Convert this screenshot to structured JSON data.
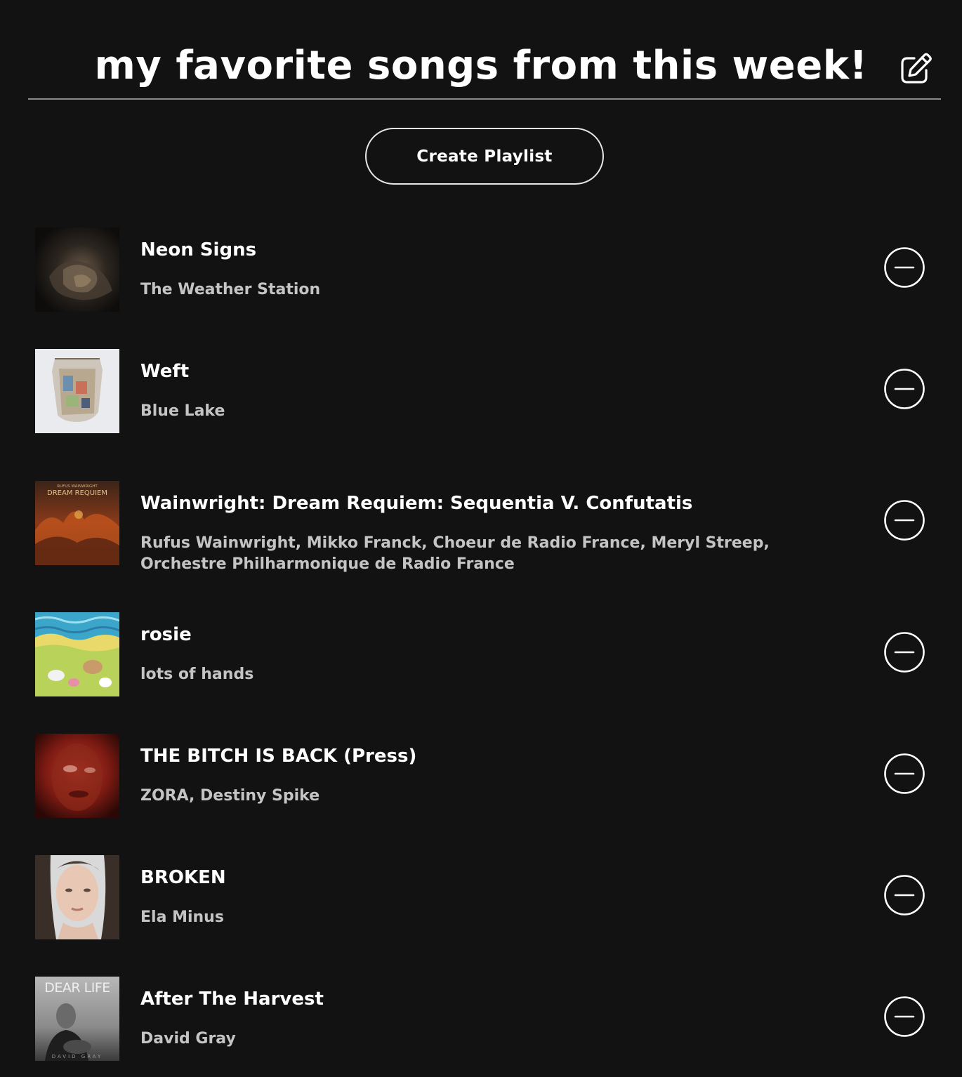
{
  "header": {
    "title": "my favorite songs from this week!",
    "edit_icon": "edit-square-pencil-icon"
  },
  "actions": {
    "create_playlist_label": "Create Playlist"
  },
  "colors": {
    "background": "#121212",
    "text_primary": "#ffffff",
    "text_secondary": "#c4c4c4",
    "divider": "#8a8a8a"
  },
  "tracks": [
    {
      "title": "Neon Signs",
      "artist": "The Weather Station",
      "remove_icon": "minus-circle-icon"
    },
    {
      "title": "Weft",
      "artist": "Blue Lake",
      "remove_icon": "minus-circle-icon"
    },
    {
      "title": "Wainwright: Dream Requiem: Sequentia V. Confutatis",
      "artist": "Rufus Wainwright, Mikko Franck, Choeur de Radio France, Meryl Streep, Orchestre Philharmonique de Radio France",
      "remove_icon": "minus-circle-icon"
    },
    {
      "title": "rosie",
      "artist": "lots of hands",
      "remove_icon": "minus-circle-icon"
    },
    {
      "title": "THE BITCH IS BACK (Press)",
      "artist": "ZORA, Destiny Spike",
      "remove_icon": "minus-circle-icon"
    },
    {
      "title": "BROKEN",
      "artist": "Ela Minus",
      "remove_icon": "minus-circle-icon"
    },
    {
      "title": "After The Harvest",
      "artist": "David Gray",
      "remove_icon": "minus-circle-icon"
    }
  ],
  "cover_art_text": {
    "track_3_line_1": "RUFUS WAINWRIGHT",
    "track_3_line_2": "DREAM REQUIEM",
    "track_7_line_1": "DEAR LIFE",
    "track_7_line_2": "DAVID GRAY"
  }
}
